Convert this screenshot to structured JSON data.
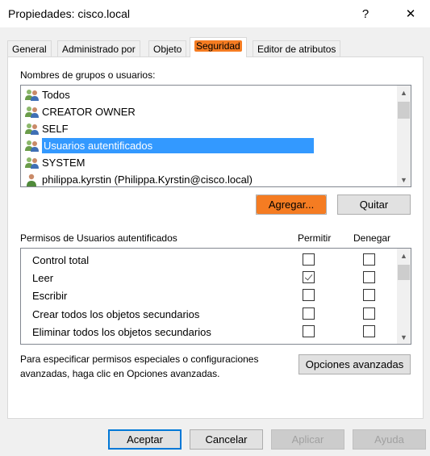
{
  "window": {
    "title": "Propiedades: cisco.local",
    "help_glyph": "?",
    "close_glyph": "✕"
  },
  "tabs": [
    {
      "label": "General"
    },
    {
      "label": "Administrado por"
    },
    {
      "label": "Objeto"
    },
    {
      "label": "Seguridad",
      "active": true
    },
    {
      "label": "Editor de atributos"
    }
  ],
  "security": {
    "groups_label": "Nombres de grupos o usuarios:",
    "groups": [
      {
        "name": "Todos",
        "icon": "group-icon"
      },
      {
        "name": "CREATOR OWNER",
        "icon": "group-icon"
      },
      {
        "name": "SELF",
        "icon": "group-icon"
      },
      {
        "name": "Usuarios autentificados",
        "icon": "group-icon",
        "selected": true
      },
      {
        "name": "SYSTEM",
        "icon": "group-icon"
      },
      {
        "name": "philippa.kyrstin (Philippa.Kyrstin@cisco.local)",
        "icon": "user-icon"
      }
    ],
    "add_button": "Agregar...",
    "remove_button": "Quitar",
    "permissions_label": "Permisos de Usuarios autentificados",
    "allow_header": "Permitir",
    "deny_header": "Denegar",
    "permissions": [
      {
        "name": "Control total",
        "allow": false,
        "deny": false
      },
      {
        "name": "Leer",
        "allow": true,
        "deny": false
      },
      {
        "name": "Escribir",
        "allow": false,
        "deny": false
      },
      {
        "name": "Crear todos los objetos secundarios",
        "allow": false,
        "deny": false
      },
      {
        "name": "Eliminar todos los objetos secundarios",
        "allow": false,
        "deny": false
      }
    ],
    "advanced_text_line1": "Para especificar permisos especiales o configuraciones",
    "advanced_text_line2": "avanzadas, haga clic en Opciones avanzadas.",
    "advanced_button": "Opciones avanzadas"
  },
  "footer": {
    "ok": "Aceptar",
    "cancel": "Cancelar",
    "apply": "Aplicar",
    "help": "Ayuda"
  },
  "colors": {
    "highlight": "#f57c22",
    "selection": "#3399ff"
  }
}
